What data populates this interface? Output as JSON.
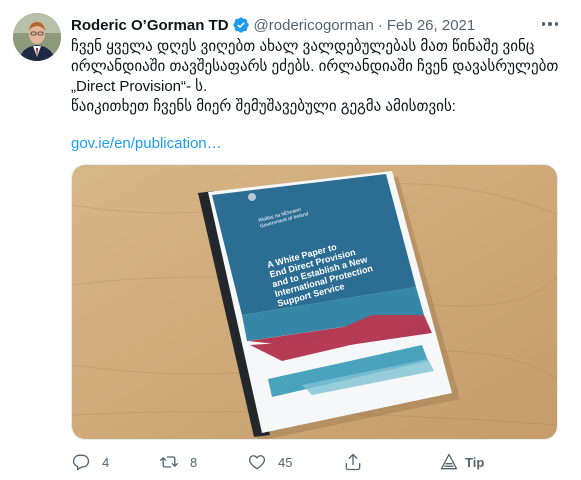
{
  "author": {
    "name": "Roderic O’Gorman TD",
    "handle": "@rodericogorman",
    "separator": "·",
    "date": "Feb 26, 2021"
  },
  "tweet": {
    "lines": [
      "ჩვენ ყველა დღეს ვიღებთ ახალ ვალდებულებას მათ წინაშე  ვინც",
      "ირლანდიაში თავშესაფარს ეძებს. ირლანდიაში ჩვენ დავასრულებთ",
      "„Direct Provision“- ს.",
      "წაიკითხეთ ჩვენს მიერ შემუშავებული გეგმა ამისთვის:"
    ],
    "link": "gov.ie/en/publication…"
  },
  "media": {
    "doc_title_lines": [
      "A White Paper to",
      "End Direct Provision",
      "and to Establish a New",
      "International Protection",
      "Support Service"
    ],
    "header_lines": [
      "Rialtas na hÉireann",
      "Government of Ireland"
    ]
  },
  "actions": {
    "replies": "4",
    "retweets": "8",
    "likes": "45",
    "tip_label": "Tip"
  },
  "colors": {
    "link": "#1d9bf0",
    "muted": "#536471",
    "verified": "#1d9bf0"
  }
}
